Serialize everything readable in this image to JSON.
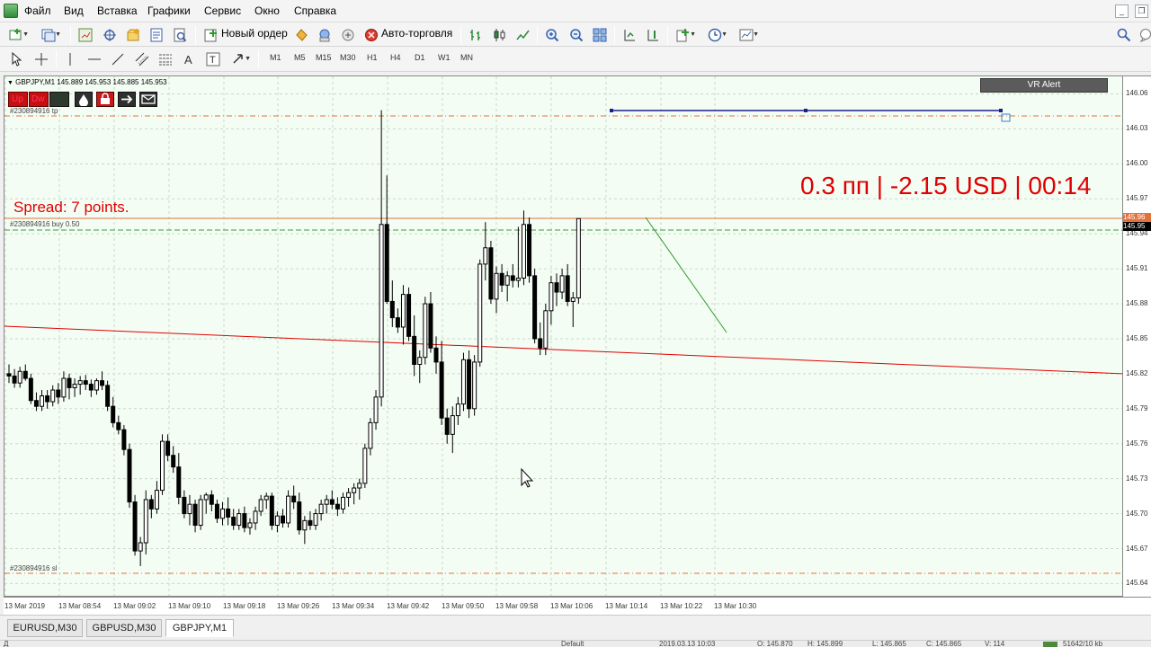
{
  "menu": [
    "Файл",
    "Вид",
    "Вставка",
    "Графики",
    "Сервис",
    "Окно",
    "Справка"
  ],
  "toolbar": {
    "new_order_label": "Новый ордер",
    "autotrading_label": "Авто-торговля"
  },
  "timeframes": [
    "M1",
    "M5",
    "M15",
    "M30",
    "H1",
    "H4",
    "D1",
    "W1",
    "MN"
  ],
  "chart": {
    "symbol_info": "GBPJPY,M1  145.889 145.953 145.885 145.953",
    "buttons": [
      "Up",
      "Dw"
    ],
    "tp_label": "#230894916 tp",
    "buy_label": "#230894916 buy 0.50",
    "sl_label": "#230894916 sl",
    "spread_text": "Spread: 7 points.",
    "pnl_text": "0.3 пп | -2.15 USD | 00:14",
    "vr_alert": "VR Alert",
    "colors": {
      "bull": "#000000",
      "bear": "#000000",
      "bull_body": "#ffffff",
      "bid_line": "#e4703a",
      "stop_level": "#e4703a",
      "trend_red": "#e00000",
      "trend_green": "#2f9a2f",
      "alert_line": "#1b1f8a",
      "text_red": "#e00000"
    }
  },
  "price_scale": [
    "146.06",
    "146.03",
    "146.00",
    "145.97",
    "145.94",
    "145.91",
    "145.88",
    "145.85",
    "145.82",
    "145.79",
    "145.76",
    "145.73",
    "145.70",
    "145.67",
    "145.64"
  ],
  "price_tags": {
    "ask": "145.96",
    "bid": "145.95"
  },
  "time_scale": [
    "13 Mar 2019",
    "13 Mar 08:54",
    "13 Mar 09:02",
    "13 Mar 09:10",
    "13 Mar 09:18",
    "13 Mar 09:26",
    "13 Mar 09:34",
    "13 Mar 09:42",
    "13 Mar 09:50",
    "13 Mar 09:58",
    "13 Mar 10:06",
    "13 Mar 10:14",
    "13 Mar 10:22",
    "13 Mar 10:30"
  ],
  "tabs": [
    "EURUSD,M30",
    "GBPUSD,M30",
    "GBPJPY,M1"
  ],
  "status": {
    "left": "Д",
    "profile": "Default",
    "datetime": "2019.03.13 10:03",
    "open": "О: 145.870",
    "high": "Н: 145.899",
    "low": "L: 145.865",
    "close": "С: 145.865",
    "volume": "V: 114",
    "traffic": "51642/10 kb"
  },
  "chart_data": {
    "type": "candlestick",
    "y_ticks": [
      146.06,
      146.03,
      146.0,
      145.97,
      145.94,
      145.91,
      145.88,
      145.85,
      145.82,
      145.79,
      145.76,
      145.73,
      145.7,
      145.67,
      145.64
    ],
    "x_ticks": [
      "13 Mar 2019",
      "13 Mar 08:54",
      "13 Mar 09:02",
      "13 Mar 09:10",
      "13 Mar 09:18",
      "13 Mar 09:26",
      "13 Mar 09:34",
      "13 Mar 09:42",
      "13 Mar 09:50",
      "13 Mar 09:58",
      "13 Mar 10:06",
      "13 Mar 10:14",
      "13 Mar 10:22",
      "13 Mar 10:30"
    ],
    "ohlc": [
      [
        145.82,
        145.828,
        145.812,
        145.818
      ],
      [
        145.818,
        145.824,
        145.808,
        145.812
      ],
      [
        145.812,
        145.826,
        145.808,
        145.822
      ],
      [
        145.822,
        145.828,
        145.814,
        145.816
      ],
      [
        145.816,
        145.82,
        145.794,
        145.797
      ],
      [
        145.797,
        145.804,
        145.788,
        145.792
      ],
      [
        145.792,
        145.806,
        145.788,
        145.801
      ],
      [
        145.801,
        145.806,
        145.79,
        145.796
      ],
      [
        145.796,
        145.81,
        145.792,
        145.806
      ],
      [
        145.806,
        145.812,
        145.794,
        145.8
      ],
      [
        145.8,
        145.822,
        145.796,
        145.816
      ],
      [
        145.816,
        145.82,
        145.798,
        145.808
      ],
      [
        145.808,
        145.816,
        145.8,
        145.811
      ],
      [
        145.811,
        145.818,
        145.802,
        145.814
      ],
      [
        145.814,
        145.819,
        145.806,
        145.811
      ],
      [
        145.811,
        145.815,
        145.8,
        145.806
      ],
      [
        145.806,
        145.816,
        145.802,
        145.814
      ],
      [
        145.814,
        145.822,
        145.806,
        145.81
      ],
      [
        145.81,
        145.814,
        145.788,
        145.792
      ],
      [
        145.792,
        145.8,
        145.774,
        145.778
      ],
      [
        145.778,
        145.784,
        145.768,
        145.772
      ],
      [
        145.772,
        145.776,
        145.75,
        145.755
      ],
      [
        145.755,
        145.76,
        145.705,
        145.71
      ],
      [
        145.71,
        145.716,
        145.664,
        145.668
      ],
      [
        145.668,
        145.68,
        145.655,
        145.675
      ],
      [
        145.675,
        145.72,
        145.665,
        145.712
      ],
      [
        145.712,
        145.716,
        145.696,
        145.704
      ],
      [
        145.704,
        145.728,
        145.7,
        145.72
      ],
      [
        145.72,
        145.768,
        145.716,
        145.762
      ],
      [
        145.762,
        145.768,
        145.745,
        145.75
      ],
      [
        145.75,
        145.758,
        145.735,
        145.74
      ],
      [
        145.74,
        145.752,
        145.708,
        145.714
      ],
      [
        145.714,
        145.72,
        145.696,
        145.7
      ],
      [
        145.7,
        145.716,
        145.69,
        145.708
      ],
      [
        145.708,
        145.712,
        145.684,
        145.69
      ],
      [
        145.69,
        145.716,
        145.686,
        145.712
      ],
      [
        145.712,
        145.718,
        145.7,
        145.716
      ],
      [
        145.716,
        145.72,
        145.702,
        145.708
      ],
      [
        145.708,
        145.712,
        145.692,
        145.696
      ],
      [
        145.696,
        145.71,
        145.69,
        145.704
      ],
      [
        145.704,
        145.714,
        145.69,
        145.697
      ],
      [
        145.697,
        145.704,
        145.686,
        145.69
      ],
      [
        145.69,
        145.704,
        145.686,
        145.7
      ],
      [
        145.7,
        145.706,
        145.684,
        145.688
      ],
      [
        145.688,
        145.696,
        145.682,
        145.692
      ],
      [
        145.692,
        145.706,
        145.686,
        145.702
      ],
      [
        145.702,
        145.716,
        145.698,
        145.712
      ],
      [
        145.712,
        145.718,
        145.704,
        145.715
      ],
      [
        145.715,
        145.718,
        145.686,
        145.69
      ],
      [
        145.69,
        145.702,
        145.684,
        145.698
      ],
      [
        145.698,
        145.704,
        145.688,
        145.692
      ],
      [
        145.692,
        145.72,
        145.688,
        145.715
      ],
      [
        145.715,
        145.724,
        145.704,
        145.71
      ],
      [
        145.71,
        145.718,
        145.682,
        145.686
      ],
      [
        145.686,
        145.698,
        145.674,
        145.694
      ],
      [
        145.694,
        145.702,
        145.686,
        145.69
      ],
      [
        145.69,
        145.704,
        145.686,
        145.7
      ],
      [
        145.7,
        145.712,
        145.694,
        145.708
      ],
      [
        145.708,
        145.716,
        145.7,
        145.712
      ],
      [
        145.712,
        145.72,
        145.704,
        145.708
      ],
      [
        145.708,
        145.714,
        145.698,
        145.704
      ],
      [
        145.704,
        145.718,
        145.7,
        145.714
      ],
      [
        145.714,
        145.722,
        145.706,
        145.718
      ],
      [
        145.718,
        145.726,
        145.708,
        145.722
      ],
      [
        145.722,
        145.73,
        145.712,
        145.726
      ],
      [
        145.726,
        145.76,
        145.722,
        145.756
      ],
      [
        145.756,
        145.782,
        145.75,
        145.778
      ],
      [
        145.778,
        145.806,
        145.772,
        145.8
      ],
      [
        145.8,
        146.046,
        145.792,
        145.948
      ],
      [
        145.948,
        145.99,
        145.88,
        145.882
      ],
      [
        145.882,
        145.9,
        145.86,
        145.868
      ],
      [
        145.868,
        145.876,
        145.855,
        145.86
      ],
      [
        145.86,
        145.896,
        145.845,
        145.888
      ],
      [
        145.888,
        145.894,
        145.848,
        145.852
      ],
      [
        145.852,
        145.87,
        145.818,
        145.828
      ],
      [
        145.828,
        145.84,
        145.812,
        145.834
      ],
      [
        145.834,
        145.886,
        145.828,
        145.88
      ],
      [
        145.88,
        145.89,
        145.838,
        145.842
      ],
      [
        145.842,
        145.852,
        145.82,
        145.83
      ],
      [
        145.83,
        145.848,
        145.776,
        145.782
      ],
      [
        145.782,
        145.79,
        145.76,
        145.768
      ],
      [
        145.768,
        145.792,
        145.752,
        145.784
      ],
      [
        145.784,
        145.8,
        145.776,
        145.794
      ],
      [
        145.794,
        145.838,
        145.788,
        145.832
      ],
      [
        145.832,
        145.84,
        145.782,
        145.79
      ],
      [
        145.79,
        145.836,
        145.784,
        145.83
      ],
      [
        145.83,
        145.918,
        145.826,
        145.914
      ],
      [
        145.914,
        145.95,
        145.9,
        145.928
      ],
      [
        145.928,
        145.934,
        145.88,
        145.884
      ],
      [
        145.884,
        145.912,
        145.872,
        145.906
      ],
      [
        145.906,
        145.914,
        145.89,
        145.896
      ],
      [
        145.896,
        145.908,
        145.882,
        145.904
      ],
      [
        145.904,
        145.914,
        145.894,
        145.9
      ],
      [
        145.9,
        145.946,
        145.894,
        145.902
      ],
      [
        145.902,
        145.96,
        145.896,
        145.948
      ],
      [
        145.948,
        145.954,
        145.898,
        145.904
      ],
      [
        145.904,
        145.91,
        145.846,
        145.85
      ],
      [
        145.85,
        145.864,
        145.836,
        145.842
      ],
      [
        145.842,
        145.88,
        145.836,
        145.874
      ],
      [
        145.874,
        145.904,
        145.862,
        145.898
      ],
      [
        145.898,
        145.906,
        145.878,
        145.89
      ],
      [
        145.89,
        145.91,
        145.884,
        145.904
      ],
      [
        145.904,
        145.914,
        145.878,
        145.882
      ],
      [
        145.882,
        145.89,
        145.86,
        145.885
      ],
      [
        145.885,
        145.953,
        145.88,
        145.953
      ]
    ]
  }
}
